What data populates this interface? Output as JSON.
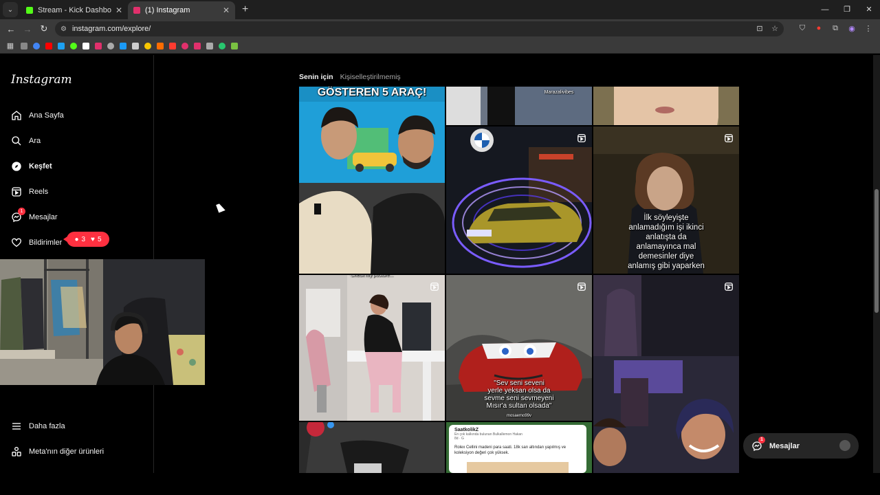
{
  "browser": {
    "tabs": [
      {
        "title": "Stream - Kick Dashboard",
        "favicon_color": "#53fc18",
        "active": false
      },
      {
        "title": "(1) Instagram",
        "favicon_color": "#e1306c",
        "active": true
      }
    ],
    "url": "instagram.com/explore/",
    "bookmark_colors": [
      "#888888",
      "#4285f4",
      "#ff0000",
      "#1da1f2",
      "#53fc18",
      "#ffffff",
      "#e1306c",
      "#aaaaaa",
      "#1b9af7",
      "#cccccc",
      "#f7c600",
      "#ff6d00",
      "#ff3b30",
      "#e1306c",
      "#e1306c",
      "#aaaaaa",
      "#28c76f",
      "#7ac142"
    ]
  },
  "sidebar": {
    "logo": "Instagram",
    "items": [
      {
        "label": "Ana Sayfa",
        "icon": "home-icon"
      },
      {
        "label": "Ara",
        "icon": "search-icon"
      },
      {
        "label": "Keşfet",
        "icon": "compass-icon"
      },
      {
        "label": "Reels",
        "icon": "reels-icon"
      },
      {
        "label": "Mesajlar",
        "icon": "messenger-icon",
        "badge": "1"
      },
      {
        "label": "Bildirimler",
        "icon": "heart-icon"
      }
    ],
    "notif_pill": {
      "comments": "3",
      "likes": "5"
    },
    "bottom_items": [
      {
        "label": "Daha fazla",
        "icon": "menu-icon"
      },
      {
        "label": "Meta'nın diğer ürünleri",
        "icon": "apps-icon"
      }
    ]
  },
  "explore": {
    "tabs": [
      "Senin için",
      "Kişiselleştirilmemiş"
    ],
    "tiles": {
      "t0_headline": "GÖSTEREN 5 ARAÇ!",
      "t1_watermark": "Marazalivibes",
      "t4_caption": [
        "İlk söyleyişte",
        "anlamadığım işi ikinci",
        "anlatışta da",
        "anlamayınca mal",
        "demesinler diye",
        "anlamış gibi yaparken"
      ],
      "t5_overlay": "Check my posture...",
      "t6_caption": [
        "\"Sev seni seveni",
        "yerle yeksan olsa da",
        "sevme seni sevmeyeni",
        "Mısır'a sultan olsada\""
      ],
      "t6_handle": "mosaemo99v",
      "t8_tweet": {
        "user": "SaatkolikZ",
        "line": "En çok kalkında bulunan  Bulkallemon Hakan",
        "sub": "8d · G",
        "text": "Rolex Cellini madeni para saati. 18k san altından yapılmış ve koleksiyon değeri çok yüksek."
      }
    }
  },
  "dm_button": {
    "label": "Mesajlar",
    "badge": "1"
  }
}
